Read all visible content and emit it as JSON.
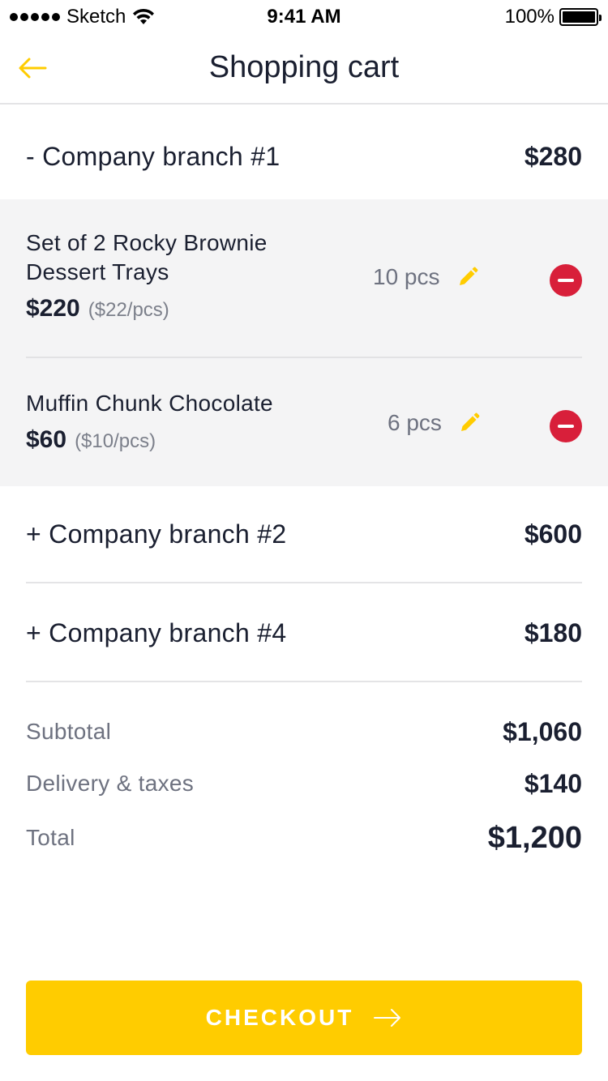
{
  "status_bar": {
    "carrier": "Sketch",
    "time": "9:41 AM",
    "battery": "100%"
  },
  "nav": {
    "title": "Shopping cart",
    "back_icon": "arrow-left-icon"
  },
  "branches": [
    {
      "label": "- Company branch #1",
      "total": "$280",
      "expanded": true
    },
    {
      "label": "+ Company branch #2",
      "total": "$600",
      "expanded": false
    },
    {
      "label": "+ Company branch #4",
      "total": "$180",
      "expanded": false
    }
  ],
  "items": [
    {
      "name_line1": "Set of 2 Rocky Brownie",
      "name_line2": "Dessert Trays",
      "price": "$220",
      "unit_price": "($22/pcs)",
      "quantity": "10 pcs"
    },
    {
      "name_line1": "Muffin Chunk Chocolate",
      "price": "$60",
      "unit_price": "($10/pcs)",
      "quantity": "6 pcs"
    }
  ],
  "summary": {
    "subtotal_label": "Subtotal",
    "subtotal_value": "$1,060",
    "delivery_label": "Delivery & taxes",
    "delivery_value": "$140",
    "total_label": "Total",
    "total_value": "$1,200"
  },
  "checkout": {
    "label": "CHECKOUT"
  },
  "colors": {
    "accent": "#ffcc00",
    "remove": "#d81f3a",
    "panel_bg": "#f4f4f5",
    "text_dark": "#1a1f30",
    "text_muted": "#6e7280"
  }
}
